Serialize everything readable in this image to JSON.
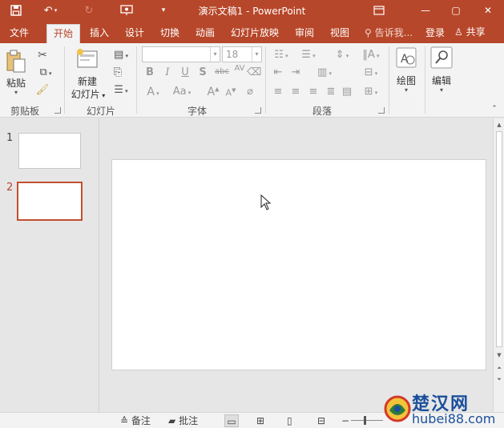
{
  "title_bar": {
    "title": "演示文稿1 - PowerPoint",
    "buttons": {
      "minimize": "—",
      "restore": "▢",
      "close": "✕"
    }
  },
  "tabs": [
    {
      "label": "文件",
      "active": false
    },
    {
      "label": "开始",
      "active": true
    },
    {
      "label": "插入",
      "active": false
    },
    {
      "label": "设计",
      "active": false
    },
    {
      "label": "切换",
      "active": false
    },
    {
      "label": "动画",
      "active": false
    },
    {
      "label": "幻灯片放映",
      "active": false
    },
    {
      "label": "审阅",
      "active": false
    },
    {
      "label": "视图",
      "active": false
    }
  ],
  "tell_me": "告诉我...",
  "sign_in": "登录",
  "share": "共享",
  "ribbon": {
    "clipboard": {
      "paste_label": "粘贴",
      "group_label": "剪贴板"
    },
    "slides": {
      "new_slide_label_1": "新建",
      "new_slide_label_2": "幻灯片",
      "group_label": "幻灯片"
    },
    "font": {
      "font_name": "",
      "font_size": "18",
      "group_label": "字体"
    },
    "paragraph": {
      "group_label": "段落"
    },
    "drawing": {
      "label": "绘图"
    },
    "editing": {
      "label": "编辑"
    }
  },
  "thumbnails": [
    {
      "number": "1",
      "active": false
    },
    {
      "number": "2",
      "active": true
    }
  ],
  "status_bar": {
    "notes_label": "备注",
    "comments_label": "批注"
  },
  "watermark": {
    "brand": "楚汉网",
    "url": "hubei88.com"
  },
  "colors": {
    "accent": "#b7472a",
    "ribbon_bg": "#f3f3f3",
    "workspace_bg": "#e6e6e6",
    "selected_thumb_border": "#c0502e"
  }
}
